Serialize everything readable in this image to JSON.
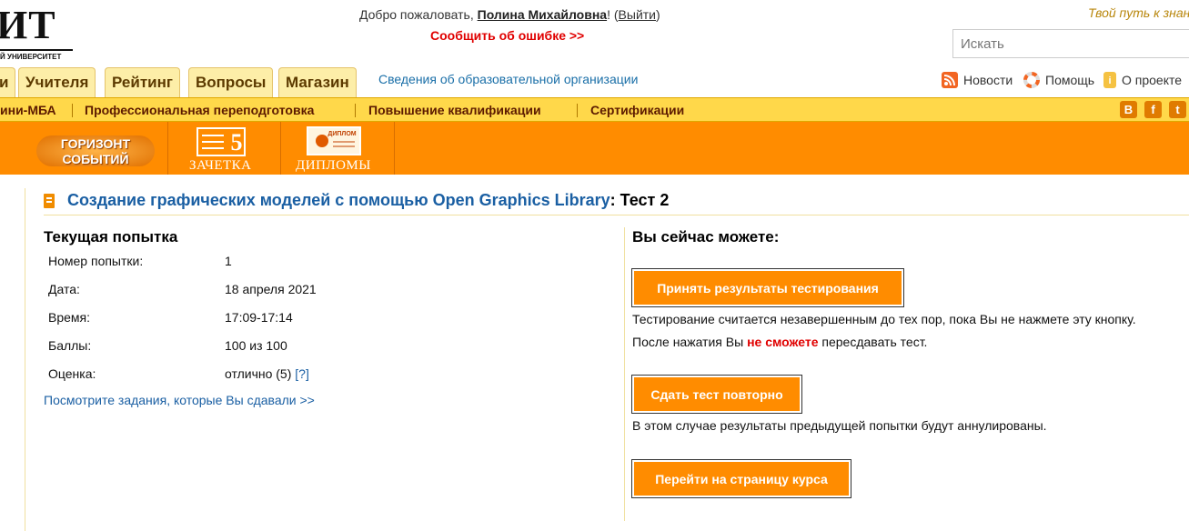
{
  "header": {
    "logo_text": "ИТ",
    "logo_subtext": "Й УНИВЕРСИТЕТ",
    "welcome_prefix": "Добро пожаловать, ",
    "user_name": "Полина Михайловна",
    "welcome_excl": "! (",
    "logout_label": "Выйти",
    "welcome_close": ")",
    "report_error": "Сообщить об ошибке >>",
    "slogan": "Твой путь к знаниям",
    "search_placeholder": "Искать"
  },
  "tabs": [
    {
      "label": "и"
    },
    {
      "label": "Учителя"
    },
    {
      "label": "Рейтинг"
    },
    {
      "label": "Вопросы"
    },
    {
      "label": "Магазин"
    }
  ],
  "org_info_link": "Сведения об образовательной организации",
  "top_links": {
    "news": "Новости",
    "help": "Помощь",
    "about": "О проекте"
  },
  "menu": {
    "items": [
      "ини-МБА",
      "Профессиональная переподготовка",
      "Повышение квалификации",
      "Сертификации"
    ],
    "social": [
      "В",
      "f",
      "t"
    ]
  },
  "banners": {
    "horizon_line1": "ГОРИЗОНТ",
    "horizon_line2": "СОБЫТИЙ",
    "zachetka_num": "5",
    "zachetka_label": "ЗАЧЕТКА",
    "diploma_badge": "ДИПЛОМ",
    "diplomas_label": "ДИПЛОМЫ"
  },
  "page": {
    "course_title": "Создание графических моделей с помощью Open Graphics Library",
    "test_suffix": ": Тест 2"
  },
  "attempt": {
    "heading": "Текущая попытка",
    "rows": [
      {
        "label": "Номер попытки:",
        "value": "1"
      },
      {
        "label": "Дата:",
        "value": "18 апреля 2021"
      },
      {
        "label": "Время:",
        "value": "17:09-17:14"
      },
      {
        "label": "Баллы:",
        "value": "100 из 100"
      },
      {
        "label": "Оценка:",
        "value": "отлично (5) "
      }
    ],
    "grade_help": "[?]",
    "see_tasks": "Посмотрите задания, которые Вы сдавали >>"
  },
  "actions": {
    "heading": "Вы сейчас можете:",
    "accept_button": "Принять результаты тестирования",
    "accept_note1": "Тестирование считается незавершенным до тех пор, пока Вы не нажмете эту кнопку.",
    "accept_note2_prefix": "После нажатия Вы ",
    "accept_note2_bold": "не сможете",
    "accept_note2_suffix": " пересдавать тест.",
    "retake_button": "Сдать тест повторно",
    "retake_note": "В этом случае результаты предыдущей попытки будут аннулированы.",
    "course_button": "Перейти на страницу курса"
  },
  "colors": {
    "orange": "#ff8c00",
    "yellow_bar": "#ffd84a",
    "link_blue": "#1a5fa3",
    "error_red": "#e00000"
  }
}
